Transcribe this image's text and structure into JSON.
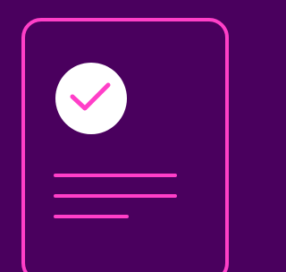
{
  "colors": {
    "background": "#4a005e",
    "accent": "#ff3fc8",
    "badge": "#ffffff"
  },
  "icons": {
    "document": "document-icon",
    "checkmark": "checkmark-icon"
  }
}
